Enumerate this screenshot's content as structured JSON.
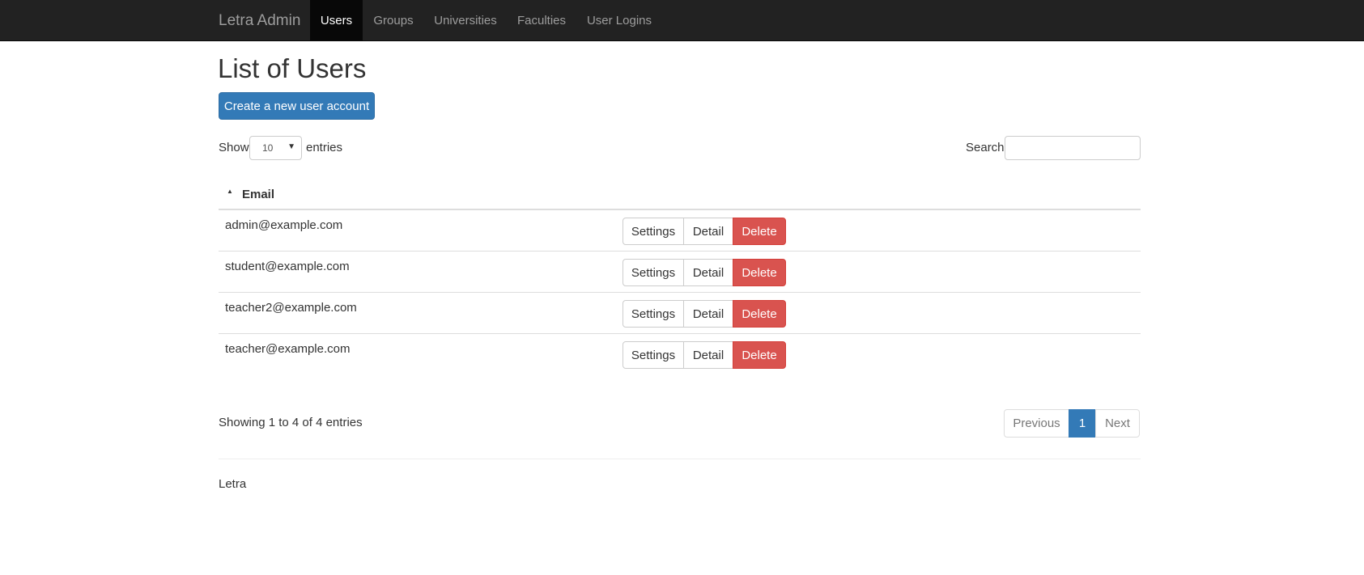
{
  "navbar": {
    "brand": "Letra Admin",
    "links": [
      {
        "label": "Users",
        "active": true
      },
      {
        "label": "Groups",
        "active": false
      },
      {
        "label": "Universities",
        "active": false
      },
      {
        "label": "Faculties",
        "active": false
      },
      {
        "label": "User Logins",
        "active": false
      }
    ]
  },
  "page": {
    "title": "List of Users",
    "create_button": "Create a new user account"
  },
  "table_controls": {
    "show_label": "Show",
    "page_length": "10",
    "entries_label": "entries",
    "search_label": "Search:",
    "search_value": ""
  },
  "table": {
    "column_header": "Email",
    "sort": "ascending",
    "rows": [
      {
        "email": "admin@example.com"
      },
      {
        "email": "student@example.com"
      },
      {
        "email": "teacher2@example.com"
      },
      {
        "email": "teacher@example.com"
      }
    ],
    "actions": {
      "settings": "Settings",
      "detail": "Detail",
      "delete": "Delete"
    }
  },
  "pagination": {
    "info": "Showing 1 to 4 of 4 entries",
    "previous": "Previous",
    "current_page": "1",
    "next": "Next"
  },
  "footer": {
    "text": "Letra"
  },
  "colors": {
    "navbar_bg": "#222222",
    "primary": "#337ab7",
    "danger": "#d9534f"
  }
}
